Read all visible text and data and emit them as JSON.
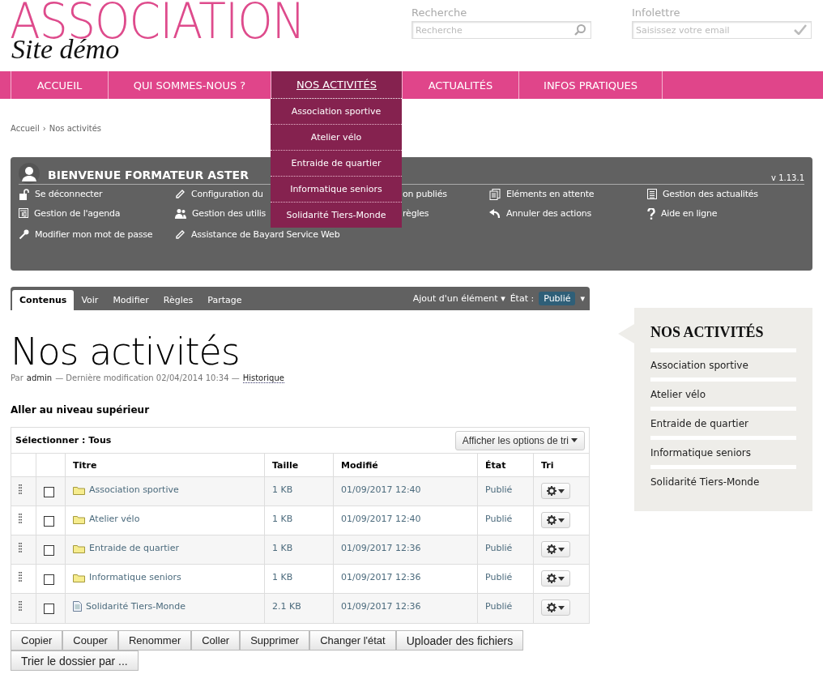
{
  "header": {
    "logo_title": "ASSOCIATION",
    "logo_subtitle": "Site démo",
    "search": {
      "label": "Recherche",
      "placeholder": "Recherche"
    },
    "newsletter": {
      "label": "Infolettre",
      "placeholder": "Saisissez votre email"
    }
  },
  "nav": [
    {
      "label": "ACCUEIL",
      "selected": false
    },
    {
      "label": "QUI SOMMES-NOUS ?",
      "selected": false
    },
    {
      "label": "NOS ACTIVITÉS",
      "selected": true,
      "expanded": true,
      "children": [
        "Association sportive",
        "Atelier vélo",
        "Entraide de quartier",
        "Informatique seniors",
        "Solidarité Tiers-Monde"
      ]
    },
    {
      "label": "ACTUALITÉS",
      "selected": false
    },
    {
      "label": "INFOS PRATIQUES",
      "selected": false
    }
  ],
  "breadcrumb": [
    "Accueil",
    "›",
    "Nos activités"
  ],
  "admin_panel": {
    "title": "BIENVENUE FORMATEUR ASTER",
    "version": "v 1.13.1",
    "columns": [
      [
        "Se déconnecter",
        "Gestion de l'agenda",
        "Modifier mon mot de passe"
      ],
      [
        "Configuration du",
        "Gestion des utilis",
        "Assistance de Bayard Service Web"
      ],
      [
        "on publiés",
        "règles"
      ],
      [
        "Eléments en attente",
        "Annuler des actions"
      ],
      [
        "Gestion des actualités",
        "Aide en ligne"
      ]
    ]
  },
  "toolbar": {
    "tabs": [
      {
        "label": "Contenus",
        "selected": true
      },
      {
        "label": "Voir",
        "selected": false
      },
      {
        "label": "Modifier",
        "selected": false
      },
      {
        "label": "Règles",
        "selected": false
      },
      {
        "label": "Partage",
        "selected": false
      }
    ],
    "add_menu": "Ajout d'un élément ▾",
    "state_label": "État :",
    "state_value": "Publié",
    "state_caret": "▾"
  },
  "page": {
    "title": "Nos activités",
    "byline": [
      "Par",
      "admin",
      "— Dernière modification 02/04/2014 10:34 —",
      "Historique"
    ],
    "up_link": "Aller au niveau supérieur"
  },
  "listing": {
    "select_label": "Sélectionner : Tous",
    "sort_button": "Afficher les options de tri",
    "columns": [
      "Titre",
      "Taille",
      "Modifié",
      "État",
      "Tri"
    ],
    "rows": [
      {
        "kind": "folder",
        "checked": false,
        "title": "Association sportive",
        "size": "1 KB",
        "modified": "01/09/2017 12:40",
        "state": "Publié"
      },
      {
        "kind": "folder",
        "checked": false,
        "title": "Atelier vélo",
        "size": "1 KB",
        "modified": "01/09/2017 12:40",
        "state": "Publié"
      },
      {
        "kind": "folder",
        "checked": false,
        "title": "Entraide de quartier",
        "size": "1 KB",
        "modified": "01/09/2017 12:36",
        "state": "Publié"
      },
      {
        "kind": "folder",
        "checked": false,
        "title": "Informatique seniors",
        "size": "1 KB",
        "modified": "01/09/2017 12:36",
        "state": "Publié"
      },
      {
        "kind": "page",
        "checked": false,
        "title": "Solidarité Tiers-Monde",
        "size": "2.1 KB",
        "modified": "01/09/2017 12:36",
        "state": "Publié"
      }
    ],
    "buttons": [
      "Copier",
      "Couper",
      "Renommer",
      "Coller",
      "Supprimer",
      "Changer l'état"
    ],
    "extra_buttons": [
      "Uploader des fichiers",
      "Trier le dossier par ..."
    ]
  },
  "portlet": {
    "title": "NOS ACTIVITÉS",
    "items": [
      "Association sportive",
      "Atelier vélo",
      "Entraide de quartier",
      "Informatique seniors",
      "Solidarité Tiers-Monde"
    ]
  }
}
